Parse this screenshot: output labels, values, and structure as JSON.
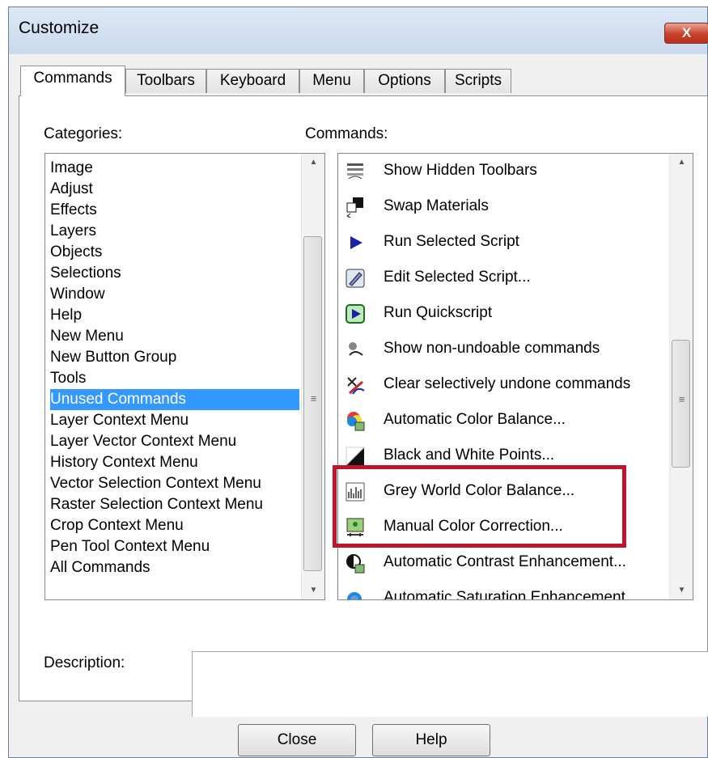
{
  "window": {
    "title": "Customize",
    "close_glyph": "X"
  },
  "tabs": [
    "Commands",
    "Toolbars",
    "Keyboard",
    "Menu",
    "Options",
    "Scripts"
  ],
  "categories_label": "Categories:",
  "commands_label": "Commands:",
  "description_label": "Description:",
  "categories": [
    "Image",
    "Adjust",
    "Effects",
    "Layers",
    "Objects",
    "Selections",
    "Window",
    "Help",
    "New Menu",
    "New Button Group",
    "Tools",
    "Unused Commands",
    "Layer Context Menu",
    "Layer Vector Context Menu",
    "History Context Menu",
    "Vector Selection Context Menu",
    "Raster Selection Context Menu",
    "Crop Context Menu",
    "Pen Tool Context Menu",
    "All Commands"
  ],
  "selected_category": "Unused Commands",
  "commands": [
    {
      "label": "Show Hidden Toolbars",
      "icon": "hidden-toolbars-icon"
    },
    {
      "label": "Swap Materials",
      "icon": "swap-materials-icon"
    },
    {
      "label": "Run Selected Script",
      "icon": "play-icon"
    },
    {
      "label": "Edit Selected Script...",
      "icon": "edit-script-icon"
    },
    {
      "label": "Run Quickscript",
      "icon": "quickscript-icon"
    },
    {
      "label": "Show non-undoable commands",
      "icon": "non-undoable-icon"
    },
    {
      "label": "Clear selectively undone commands",
      "icon": "clear-undone-icon"
    },
    {
      "label": "Automatic Color Balance...",
      "icon": "color-balance-icon"
    },
    {
      "label": "Black and White Points...",
      "icon": "black-white-points-icon"
    },
    {
      "label": "Grey World Color Balance...",
      "icon": "grey-world-icon"
    },
    {
      "label": "Manual Color Correction...",
      "icon": "manual-color-icon"
    },
    {
      "label": "Automatic Contrast Enhancement...",
      "icon": "contrast-icon"
    },
    {
      "label": "Automatic Saturation Enhancement...",
      "icon": "saturation-icon"
    }
  ],
  "highlighted_commands": [
    "Grey World Color Balance...",
    "Manual Color Correction..."
  ],
  "highlight_color": "#c0142c",
  "selection_color": "#3399ff",
  "buttons": {
    "close": "Close",
    "help": "Help"
  }
}
